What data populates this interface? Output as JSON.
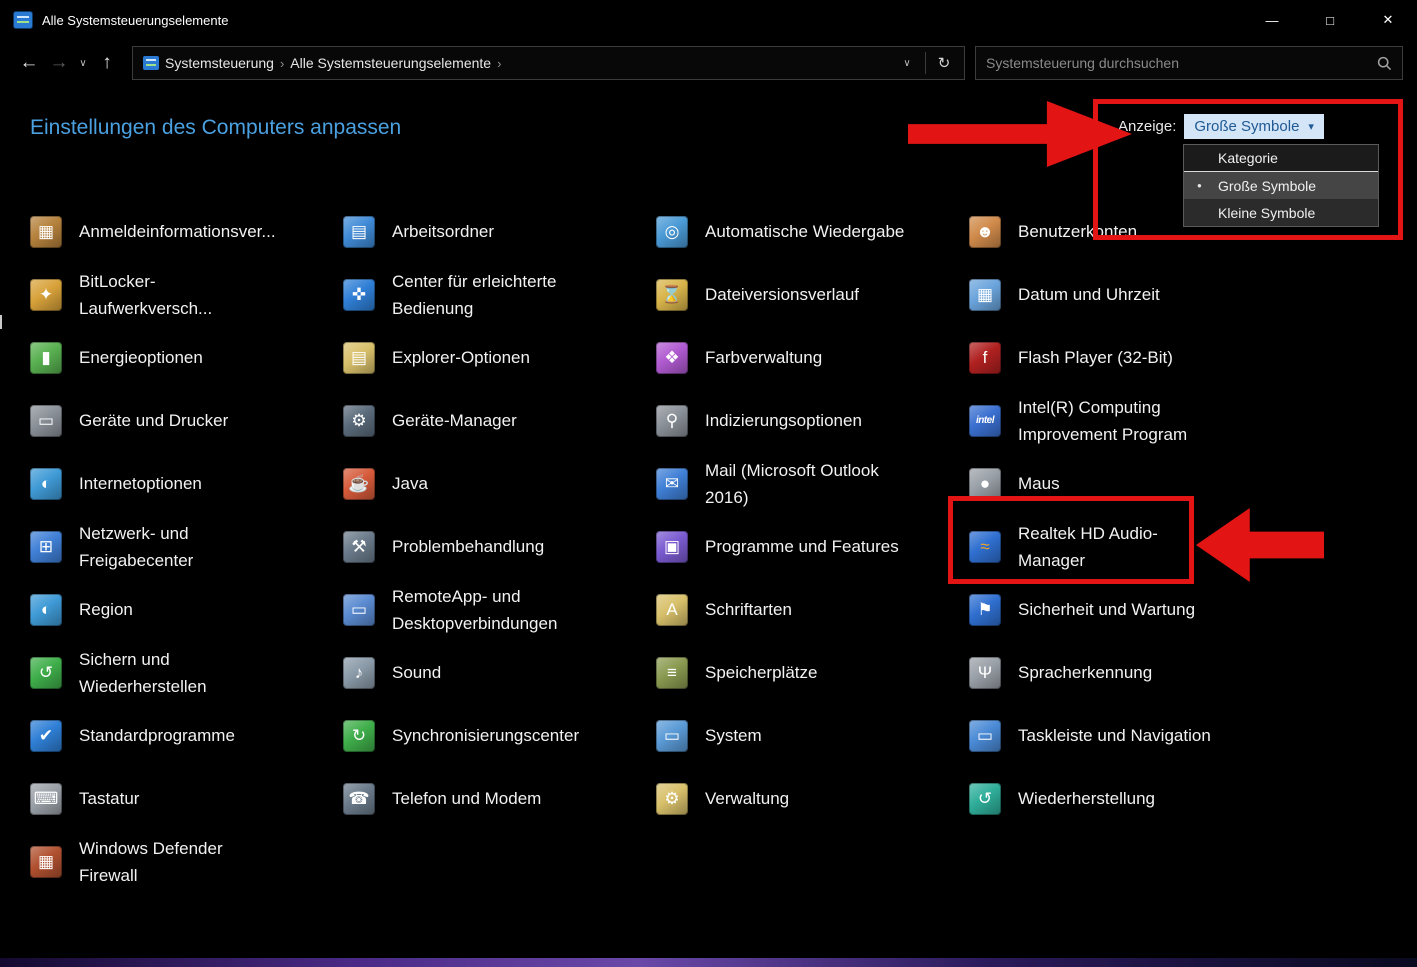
{
  "titlebar": {
    "title": "Alle Systemsteuerungselemente",
    "minimize": "—",
    "maximize": "□",
    "close": "✕"
  },
  "navbar": {
    "back_icon": "←",
    "forward_icon": "→",
    "history_dropdown_icon": "∨",
    "up_icon": "↑",
    "breadcrumb": [
      "Systemsteuerung",
      "Alle Systemsteuerungselemente"
    ],
    "separator": "›",
    "address_dropdown_icon": "∨",
    "refresh_icon": "↻",
    "search_placeholder": "Systemsteuerung durchsuchen"
  },
  "header": {
    "title": "Einstellungen des Computers anpassen"
  },
  "view_control": {
    "label": "Anzeige:",
    "value": "Große Symbole",
    "caret": "▾"
  },
  "view_menu": {
    "bullet": "●",
    "items": [
      {
        "label": "Kategorie",
        "selected": false
      },
      {
        "label": "Große Symbole",
        "selected": true
      },
      {
        "label": "Kleine Symbole",
        "selected": false
      }
    ]
  },
  "items": [
    {
      "id": "anmeldeinformationsverwaltung",
      "label": "Anmeldeinformationsver...",
      "icon": "credential-manager-icon",
      "glyph": "▦",
      "color": "#b5813c"
    },
    {
      "id": "arbeitsordner",
      "label": "Arbeitsordner",
      "icon": "work-folders-icon",
      "glyph": "▤",
      "color": "#3f8ad6"
    },
    {
      "id": "automatische-wiedergabe",
      "label": "Automatische Wiedergabe",
      "icon": "autoplay-icon",
      "glyph": "◎",
      "color": "#4a9ad6"
    },
    {
      "id": "benutzerkonten",
      "label": "Benutzerkonten",
      "icon": "user-accounts-icon",
      "glyph": "☻",
      "color": "#d08a4a"
    },
    {
      "id": "bitlocker",
      "label": "BitLocker-Laufwerkversch...",
      "icon": "bitlocker-icon",
      "glyph": "✦",
      "color": "#d8a23a"
    },
    {
      "id": "erleichterte-bedienung",
      "label": "Center für erleichterte Bedienung",
      "icon": "ease-of-access-icon",
      "glyph": "✜",
      "color": "#2f7fd6"
    },
    {
      "id": "dateiversionsverlauf",
      "label": "Dateiversionsverlauf",
      "icon": "file-history-icon",
      "glyph": "⌛",
      "color": "#d8b44a"
    },
    {
      "id": "datum-und-uhrzeit",
      "label": "Datum und Uhrzeit",
      "icon": "date-time-icon",
      "glyph": "▦",
      "color": "#6aa4dc"
    },
    {
      "id": "energieoptionen",
      "label": "Energieoptionen",
      "icon": "power-options-icon",
      "glyph": "▮",
      "color": "#58b050"
    },
    {
      "id": "explorer-optionen",
      "label": "Explorer-Optionen",
      "icon": "explorer-options-icon",
      "glyph": "▤",
      "color": "#d8c06a"
    },
    {
      "id": "farbverwaltung",
      "label": "Farbverwaltung",
      "icon": "color-management-icon",
      "glyph": "❖",
      "color": "#b05ad0"
    },
    {
      "id": "flash-player",
      "label": "Flash Player (32-Bit)",
      "icon": "flash-player-icon",
      "glyph": "f",
      "color": "#b02020"
    },
    {
      "id": "geraete-und-drucker",
      "label": "Geräte und Drucker",
      "icon": "devices-printers-icon",
      "glyph": "▭",
      "color": "#8a9098"
    },
    {
      "id": "geraete-manager",
      "label": "Geräte-Manager",
      "icon": "device-manager-icon",
      "glyph": "⚙",
      "color": "#5a6a7a"
    },
    {
      "id": "indizierungsoptionen",
      "label": "Indizierungsoptionen",
      "icon": "indexing-options-icon",
      "glyph": "⚲",
      "color": "#8a9098"
    },
    {
      "id": "intel-computing-improvement",
      "label": "Intel(R) Computing Improvement Program",
      "icon": "intel-icon",
      "glyph": "intel",
      "color": "#3a6fd0"
    },
    {
      "id": "internetoptionen",
      "label": "Internetoptionen",
      "icon": "internet-options-icon",
      "glyph": "◐",
      "color": "#3f9ad6"
    },
    {
      "id": "java",
      "label": "Java",
      "icon": "java-icon",
      "glyph": "☕",
      "color": "#d65a3a"
    },
    {
      "id": "mail-outlook",
      "label": "Mail (Microsoft Outlook 2016)",
      "icon": "mail-icon",
      "glyph": "✉",
      "color": "#3f7fd6"
    },
    {
      "id": "maus",
      "label": "Maus",
      "icon": "mouse-icon",
      "glyph": "●",
      "color": "#9aa0a8"
    },
    {
      "id": "netzwerk-freigabecenter",
      "label": "Netzwerk- und Freigabecenter",
      "icon": "network-sharing-icon",
      "glyph": "⊞",
      "color": "#3f7fd6"
    },
    {
      "id": "problembehandlung",
      "label": "Problembehandlung",
      "icon": "troubleshooting-icon",
      "glyph": "⚒",
      "color": "#6a7a8a"
    },
    {
      "id": "programme-und-features",
      "label": "Programme und Features",
      "icon": "programs-features-icon",
      "glyph": "▣",
      "color": "#7a5ad0"
    },
    {
      "id": "realtek-hd-audio-manager",
      "label": "Realtek HD Audio-Manager",
      "icon": "realtek-audio-icon",
      "glyph": "≈",
      "color": "#2f6fd0",
      "glyph_color": "#f5a623"
    },
    {
      "id": "region",
      "label": "Region",
      "icon": "region-icon",
      "glyph": "◐",
      "color": "#3f9ad6"
    },
    {
      "id": "remoteapp-desktopverbindungen",
      "label": "RemoteApp- und Desktopverbindungen",
      "icon": "remoteapp-icon",
      "glyph": "▭",
      "color": "#5a8ad0"
    },
    {
      "id": "schriftarten",
      "label": "Schriftarten",
      "icon": "fonts-icon",
      "glyph": "A",
      "color": "#d8c06a"
    },
    {
      "id": "sicherheit-und-wartung",
      "label": "Sicherheit und Wartung",
      "icon": "security-maintenance-icon",
      "glyph": "⚑",
      "color": "#2f6fd0"
    },
    {
      "id": "sichern-und-wiederherstellen",
      "label": "Sichern und Wiederherstellen",
      "icon": "backup-restore-icon",
      "glyph": "↺",
      "color": "#3fae4a"
    },
    {
      "id": "sound",
      "label": "Sound",
      "icon": "sound-icon",
      "glyph": "♪",
      "color": "#8a9aa8"
    },
    {
      "id": "speicherplaetze",
      "label": "Speicherplätze",
      "icon": "storage-spaces-icon",
      "glyph": "≡",
      "color": "#8a9a50"
    },
    {
      "id": "spracherkennung",
      "label": "Spracherkennung",
      "icon": "speech-recognition-icon",
      "glyph": "Ψ",
      "color": "#9aa0a8"
    },
    {
      "id": "standardprogramme",
      "label": "Standardprogramme",
      "icon": "default-programs-icon",
      "glyph": "✔",
      "color": "#2f7fd6"
    },
    {
      "id": "synchronisierungscenter",
      "label": "Synchronisierungscenter",
      "icon": "sync-center-icon",
      "glyph": "↻",
      "color": "#3fae4a"
    },
    {
      "id": "system",
      "label": "System",
      "icon": "system-icon",
      "glyph": "▭",
      "color": "#5a9ad6"
    },
    {
      "id": "taskleiste-und-navigation",
      "label": "Taskleiste und Navigation",
      "icon": "taskbar-icon",
      "glyph": "▭",
      "color": "#4a8ad6"
    },
    {
      "id": "tastatur",
      "label": "Tastatur",
      "icon": "keyboard-icon",
      "glyph": "⌨",
      "color": "#9aa0a8"
    },
    {
      "id": "telefon-und-modem",
      "label": "Telefon und Modem",
      "icon": "phone-modem-icon",
      "glyph": "☎",
      "color": "#6a7a8a"
    },
    {
      "id": "verwaltung",
      "label": "Verwaltung",
      "icon": "administrative-tools-icon",
      "glyph": "⚙",
      "color": "#d8c06a"
    },
    {
      "id": "wiederherstellung",
      "label": "Wiederherstellung",
      "icon": "recovery-icon",
      "glyph": "↺",
      "color": "#2fae9a"
    },
    {
      "id": "windows-defender-firewall",
      "label": "Windows Defender Firewall",
      "icon": "firewall-icon",
      "glyph": "▦",
      "color": "#b0502f"
    }
  ],
  "annotations": {
    "color": "#e31414",
    "targets": [
      "view-dropdown-and-menu",
      "realtek-hd-audio-manager"
    ]
  },
  "colors": {
    "background": "#000000",
    "accent_link": "#4aa0e0",
    "item_text": "#f2f2f2",
    "view_button_bg": "#d3e5f7",
    "view_button_fg": "#215a94"
  }
}
